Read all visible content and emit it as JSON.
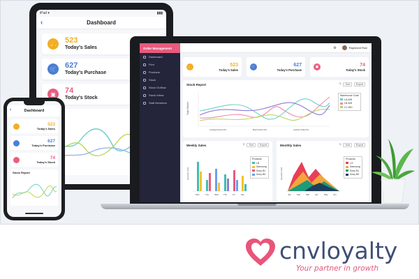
{
  "colors": {
    "sales": "#f3ae27",
    "purchase": "#4a7ed8",
    "stock": "#ec5c7e",
    "sidebar": "#24243a",
    "sidebar_header": "#e85a7e",
    "brand_heart": "#e9557a",
    "brand_text": "#3f4f74"
  },
  "tablet": {
    "title": "Dashboard",
    "kpis": [
      {
        "value": "523",
        "label": "Today's Sales",
        "icon": "thumbs-up-icon"
      },
      {
        "value": "627",
        "label": "Today's Purchase",
        "icon": "cart-icon"
      },
      {
        "value": "74",
        "label": "Today's Stock",
        "icon": "box-icon"
      }
    ]
  },
  "phone": {
    "title": "Dashboard",
    "kpis": [
      {
        "value": "523",
        "label": "Today's Sales"
      },
      {
        "value": "627",
        "label": "Today's Purchase"
      },
      {
        "value": "74",
        "label": "Today's Stock"
      }
    ],
    "chart_title": "Stock Report"
  },
  "laptop": {
    "sidebar_header": "Order Management",
    "sidebar_items": [
      "Dashboard",
      "Firm",
      "Products",
      "Stock",
      "Stock Outflow",
      "Stock Inflow",
      "Staff Members"
    ],
    "user_name": "Raymond Ruiz",
    "kpis": [
      {
        "value": "523",
        "label": "Today's Sales"
      },
      {
        "value": "627",
        "label": "Today's Purchase"
      },
      {
        "value": "74",
        "label": "Today's Stock"
      }
    ],
    "stock_report": {
      "title": "Stock Report",
      "ylabel": "Total Stocks",
      "legend_title": "Warehouse Code",
      "series": [
        "LA-WH",
        "LB-WH",
        "LC-WH"
      ],
      "categories": [
        "L4 Electronics Pvt.",
        "Buchi Kid's Pvt.",
        "Anchor Polls Pvt."
      ],
      "tools": [
        "Sort",
        "Export"
      ]
    },
    "weekly_sales": {
      "title": "Weekly Sales",
      "ylabel": "Quantity Sold",
      "categories": [
        "Mon",
        "Tue",
        "Wed",
        "Thu",
        "Fri",
        "Sat"
      ],
      "legend": [
        "Products",
        "LB",
        "Samsung",
        "Sony B1",
        "Sony B3"
      ],
      "tools": [
        "Sort",
        "Export"
      ]
    },
    "monthly_sales": {
      "title": "Monthly Sales",
      "ylabel": "Quantity Sold",
      "categories": [
        "Jan",
        "Feb",
        "Mar",
        "Apr",
        "May",
        "Jun"
      ],
      "legend": [
        "Products",
        "LG",
        "Samsung",
        "Sony B1",
        "Sony B3"
      ],
      "tools": [
        "Sort",
        "Export"
      ]
    }
  },
  "brand": {
    "name": "cnvloyalty",
    "tagline": "Your partner in growth"
  }
}
